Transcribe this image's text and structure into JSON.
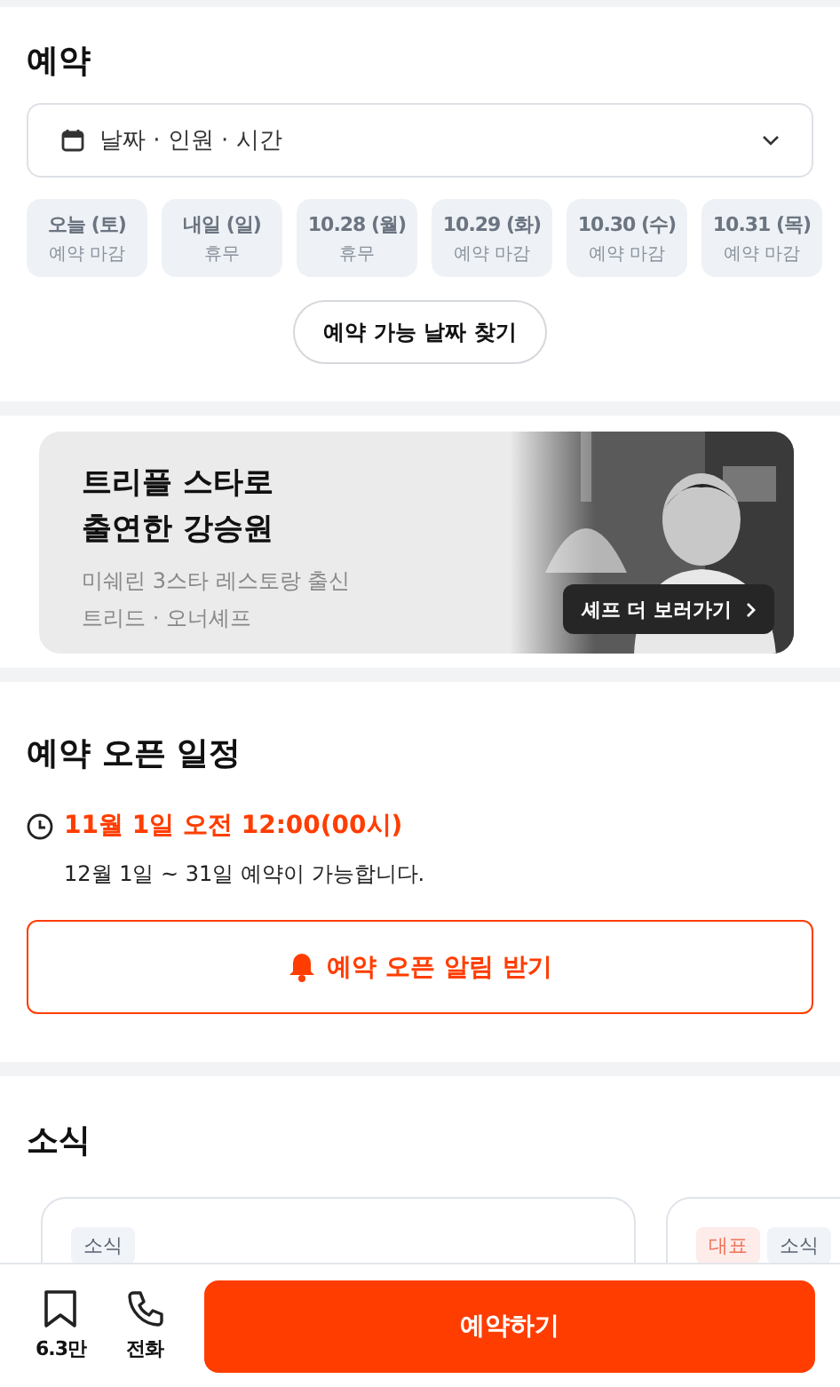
{
  "reservation": {
    "title": "예약",
    "selector": {
      "placeholder": "날짜 · 인원 · 시간"
    },
    "dates": [
      {
        "date": "오늘 (토)",
        "status": "예약 마감"
      },
      {
        "date": "내일 (일)",
        "status": "휴무"
      },
      {
        "date": "10.28 (월)",
        "status": "휴무"
      },
      {
        "date": "10.29 (화)",
        "status": "예약 마감"
      },
      {
        "date": "10.30 (수)",
        "status": "예약 마감"
      },
      {
        "date": "10.31 (목)",
        "status": "예약 마감"
      }
    ],
    "find_button": "예약 가능 날짜 찾기"
  },
  "banner": {
    "title_lines": [
      "트리플 스타로",
      "출연한 강승원"
    ],
    "subtitle_lines": [
      "미쉐린 3스타 레스토랑 출신",
      "트리드 · 오너셰프"
    ],
    "button": "셰프 더 보러가기"
  },
  "open_schedule": {
    "title": "예약 오픈 일정",
    "open_time": "11월 1일 오전 12:00(00시)",
    "note": "12월 1일 ~ 31일 예약이 가능합니다.",
    "alert_button": "예약 오픈 알림 받기"
  },
  "news": {
    "title": "소식",
    "cards": [
      {
        "tags": [
          {
            "label": "소식",
            "color": "#f0f3f7"
          }
        ]
      },
      {
        "tags": [
          {
            "label": "대표",
            "color": "#fdecea"
          },
          {
            "label": "소식",
            "color": "#f0f3f7"
          }
        ]
      }
    ]
  },
  "bottom_bar": {
    "bookmark_count": "6.3만",
    "call_label": "전화",
    "reserve_button": "예약하기"
  }
}
